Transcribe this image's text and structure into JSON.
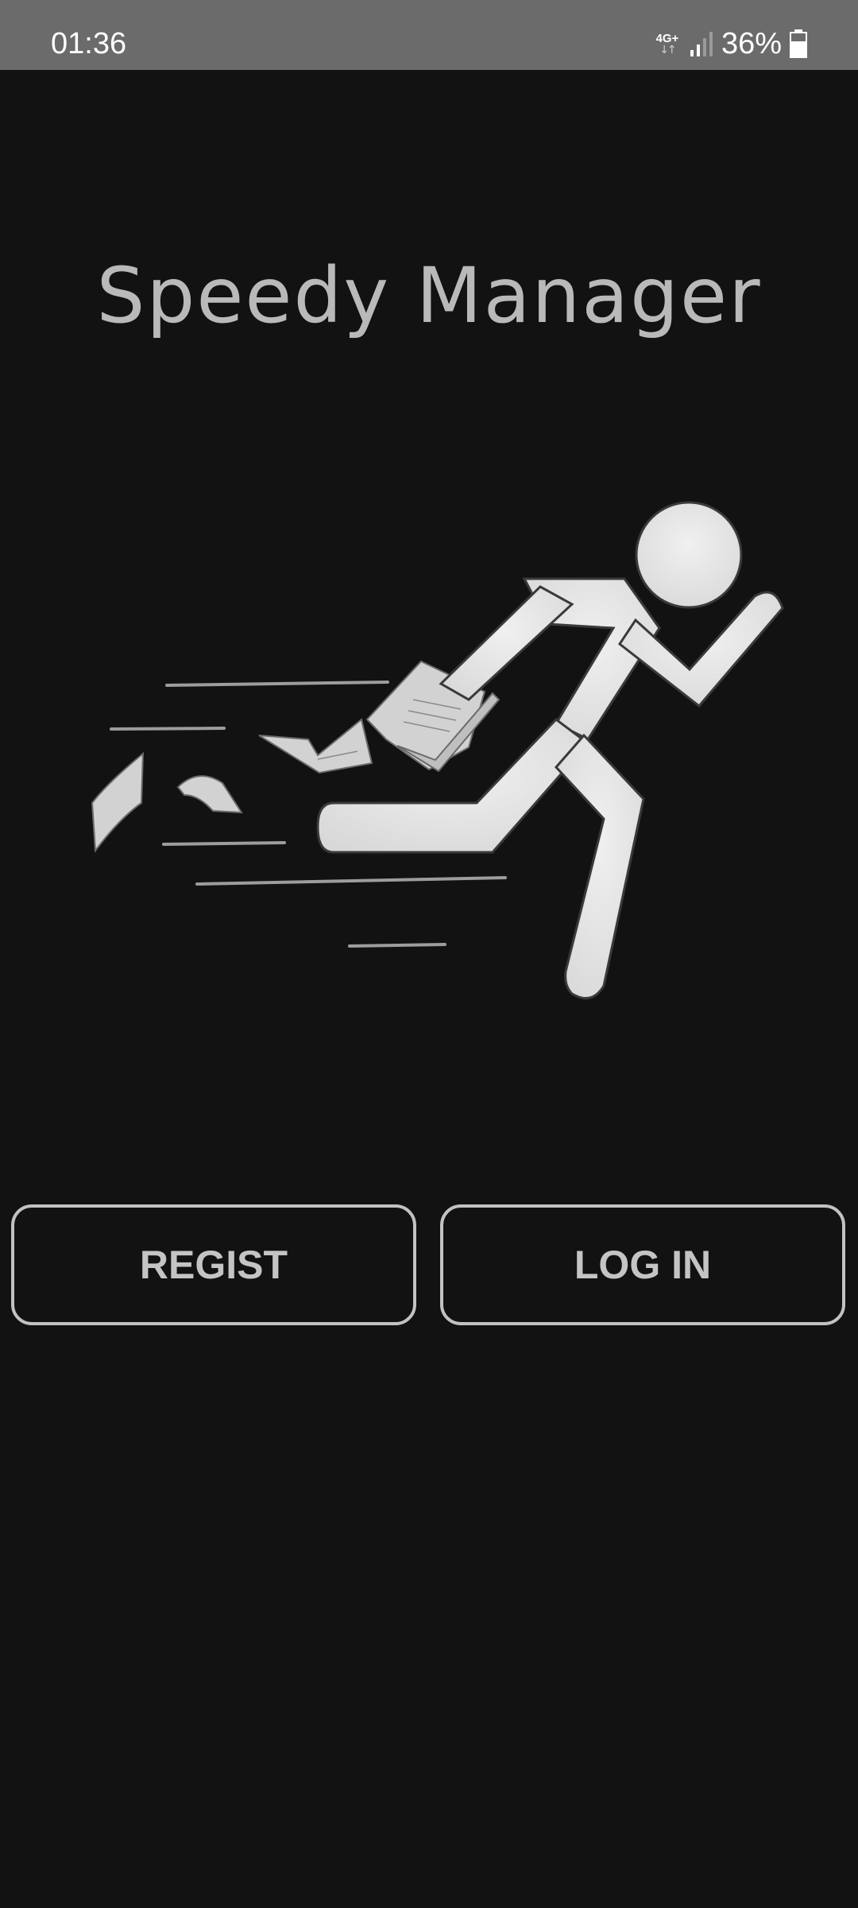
{
  "status_bar": {
    "time": "01:36",
    "network_type": "4G+",
    "network_arrows": "↓↑",
    "battery_percent": "36%",
    "icons": [
      "network-type-icon",
      "signal-icon",
      "battery-icon"
    ]
  },
  "app": {
    "title": "Speedy Manager",
    "illustration": "running-man-with-papers-icon"
  },
  "actions": {
    "register_label": "REGIST",
    "login_label": "LOG IN"
  },
  "colors": {
    "background": "#121212",
    "status_bar": "#6b6b6b",
    "title_text": "#b9b9b9",
    "button_border": "#c2c2c2",
    "figure_fill": "#e6e6e6"
  }
}
